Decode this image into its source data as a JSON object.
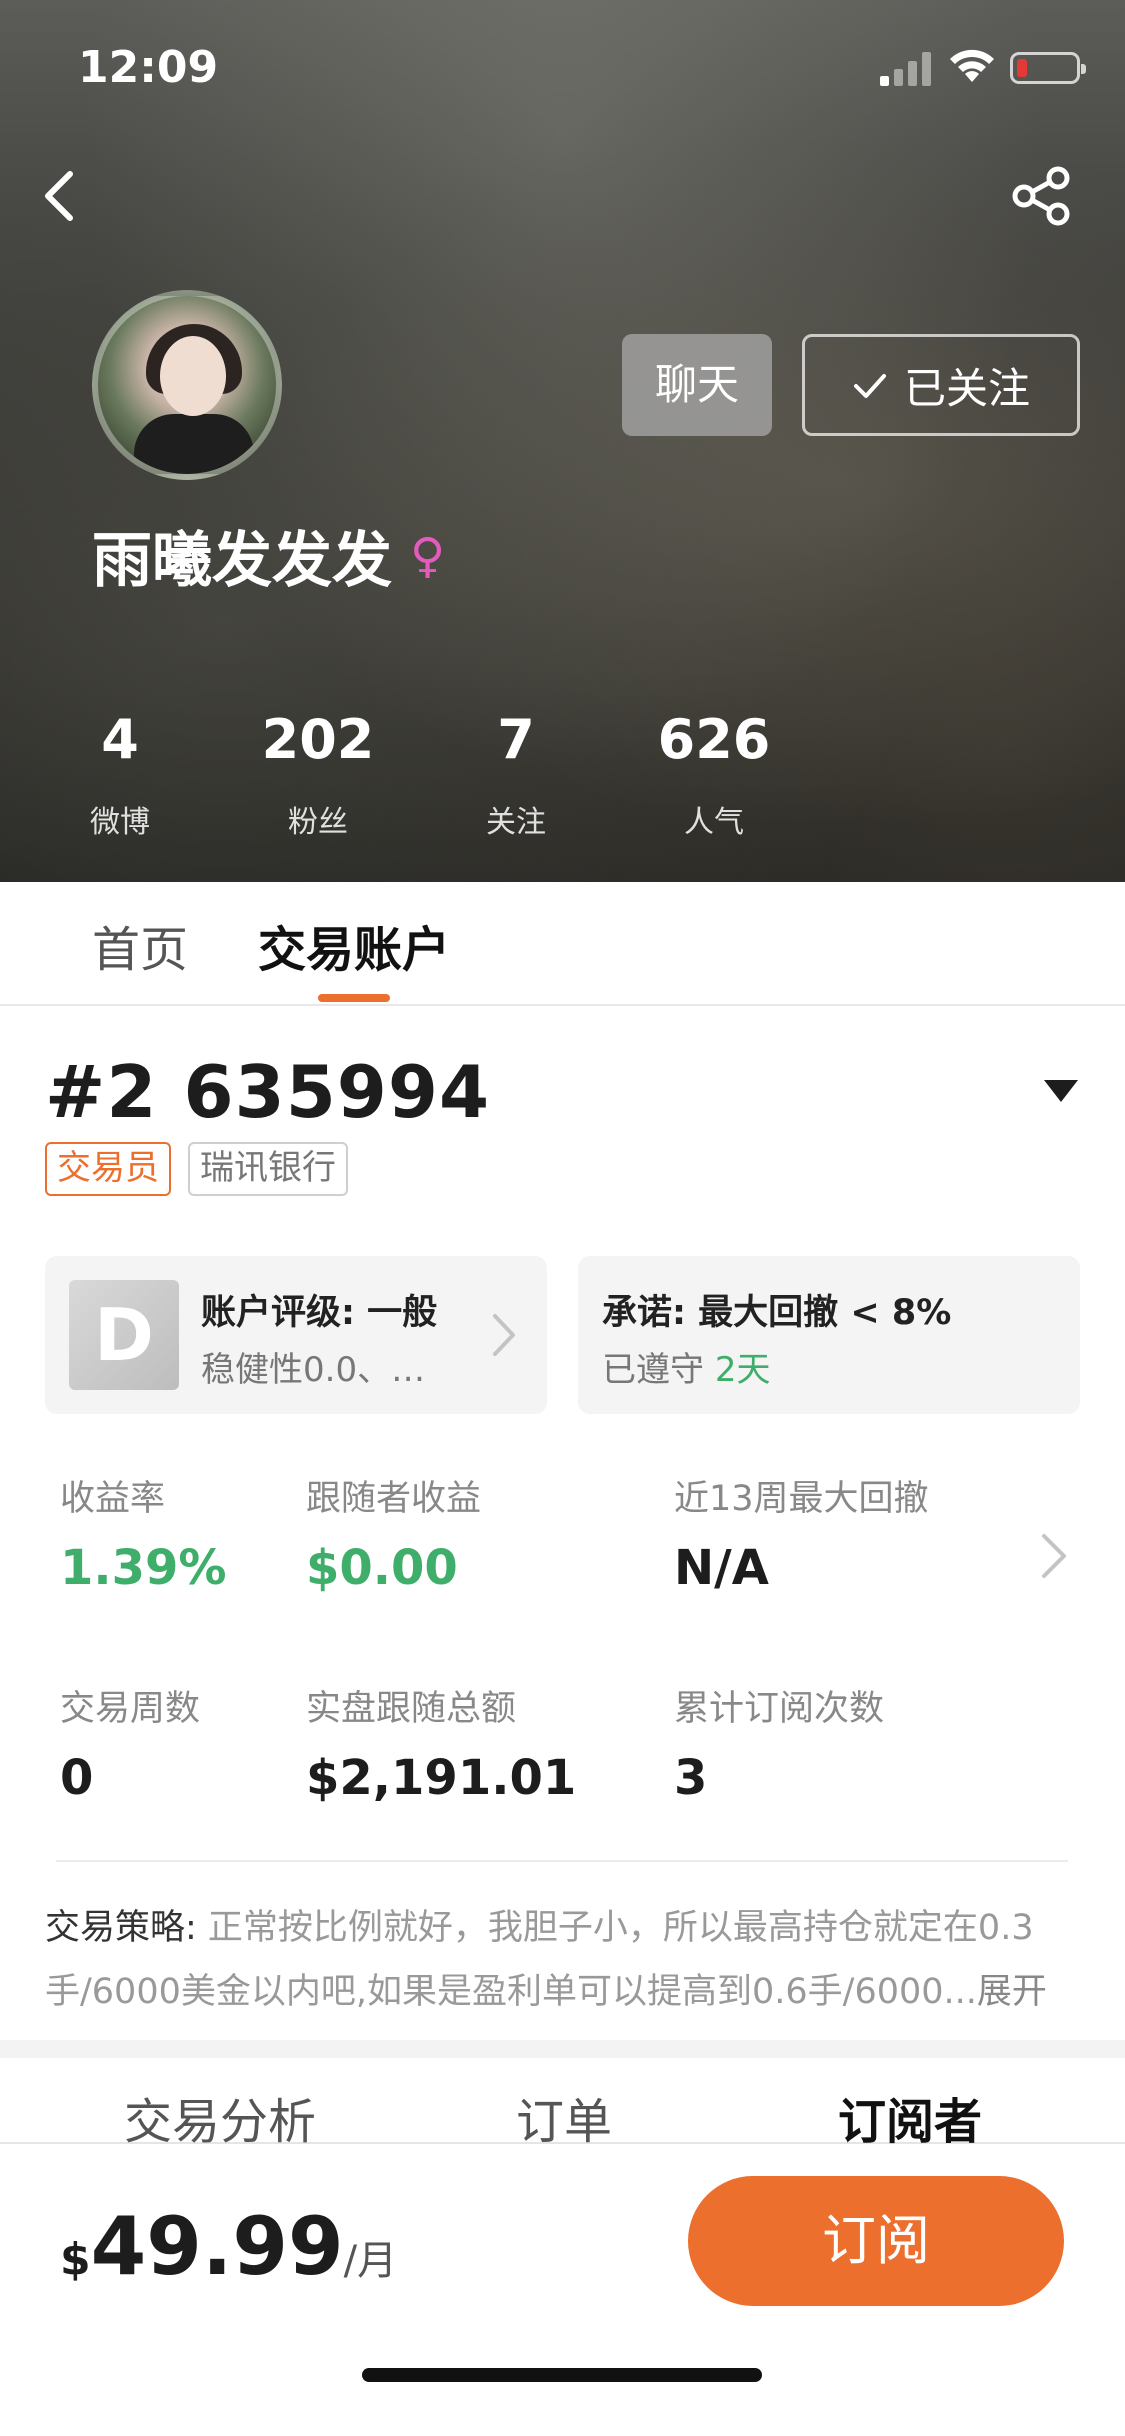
{
  "status_bar": {
    "time": "12:09"
  },
  "profile": {
    "chat_label": "聊天",
    "follow_label": "已关注",
    "username": "雨曦发发发",
    "gender_symbol": "♀",
    "stats": [
      {
        "value": "4",
        "label": "微博"
      },
      {
        "value": "202",
        "label": "粉丝"
      },
      {
        "value": "7",
        "label": "关注"
      },
      {
        "value": "626",
        "label": "人气"
      }
    ]
  },
  "tabs": [
    {
      "label": "首页",
      "active": false
    },
    {
      "label": "交易账户",
      "active": true
    }
  ],
  "account": {
    "id": "#2 635994",
    "tags": [
      "交易员",
      "瑞讯银行"
    ],
    "rating_grade": "D",
    "rating_title": "账户评级: 一般",
    "rating_sub": "稳健性0.0、…",
    "promise_title": "承诺: 最大回撤 < 8%",
    "promise_sub_prefix": "已遵守 ",
    "promise_sub_days": "2天"
  },
  "metrics": [
    {
      "label": "收益率",
      "value": "1.39%",
      "color": "#3fae6b"
    },
    {
      "label": "跟随者收益",
      "value": "$0.00",
      "color": "#3fae6b"
    },
    {
      "label": "近13周最大回撤",
      "value": "N/A",
      "color": "#1d1d1d"
    },
    {
      "label": "交易周数",
      "value": "0",
      "color": "#1d1d1d"
    },
    {
      "label": "实盘跟随总额",
      "value": "$2,191.01",
      "color": "#1d1d1d"
    },
    {
      "label": "累计订阅次数",
      "value": "3",
      "color": "#1d1d1d"
    }
  ],
  "strategy": {
    "label": "交易策略: ",
    "text": "正常按比例就好，我胆子小，所以最高持仓就定在0.3手/6000美金以内吧,如果是盈利单可以提高到0.6手/6000...",
    "more_label": "展开"
  },
  "sub_tabs": [
    {
      "label": "交易分析",
      "active": false
    },
    {
      "label": "订单",
      "active": false
    },
    {
      "label": "订阅者",
      "active": true
    }
  ],
  "bottom": {
    "currency": "$",
    "amount": "49.99",
    "unit": "/月",
    "subscribe_label": "订阅"
  },
  "colors": {
    "accent": "#ec6f2d",
    "positive": "#3fae6b",
    "female": "#e35bbd",
    "battery_low": "#e53935"
  },
  "icons": [
    "back-icon",
    "share-icon",
    "check-icon",
    "female-icon",
    "dropdown-triangle-icon",
    "chevron-right-icon",
    "signal-icon",
    "wifi-icon",
    "battery-icon"
  ]
}
